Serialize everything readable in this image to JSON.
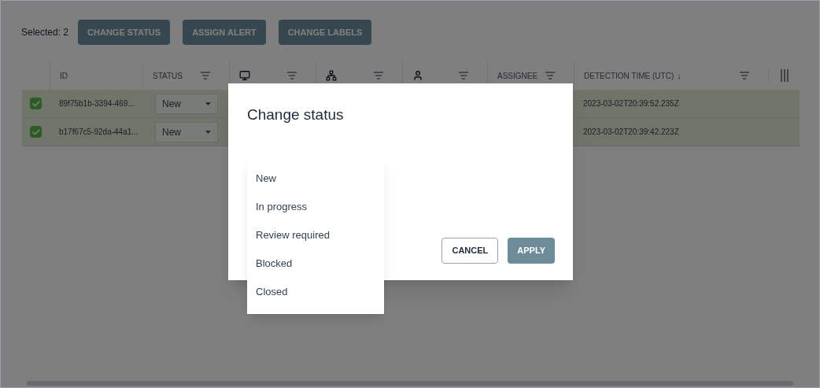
{
  "toolbar": {
    "selected_label": "Selected: 2",
    "buttons": [
      "CHANGE STATUS",
      "ASSIGN ALERT",
      "CHANGE LABELS"
    ]
  },
  "table": {
    "columns": [
      {
        "kind": "text",
        "label": "ID",
        "filter": false
      },
      {
        "kind": "text",
        "label": "STATUS",
        "filter": true
      },
      {
        "kind": "monitor",
        "filter": true
      },
      {
        "kind": "network",
        "filter": true
      },
      {
        "kind": "person",
        "filter": true
      },
      {
        "kind": "text",
        "label": "ASSIGNEE",
        "filter": true
      },
      {
        "kind": "text",
        "label": "DETECTION TIME (UTC)",
        "sort_arrow": "↓",
        "filter": true
      }
    ],
    "rows": [
      {
        "checked": true,
        "id": "89f75b1b-3394-469...",
        "status": "New",
        "detection_time": "2023-03-02T20:39:52.235Z"
      },
      {
        "checked": true,
        "id": "b17f67c5-92da-44a1...",
        "status": "New",
        "detection_time": "2023-03-02T20:39:42.223Z"
      }
    ]
  },
  "dialog": {
    "title": "Change status",
    "buttons": [
      {
        "label": "CANCEL",
        "kind": "secondary"
      },
      {
        "label": "APPLY",
        "kind": "primary"
      }
    ]
  },
  "dropdown": {
    "options": [
      {
        "label": "New"
      },
      {
        "label": "In progress"
      },
      {
        "label": "Review required"
      },
      {
        "label": "Blocked"
      },
      {
        "label": "Closed"
      }
    ]
  }
}
